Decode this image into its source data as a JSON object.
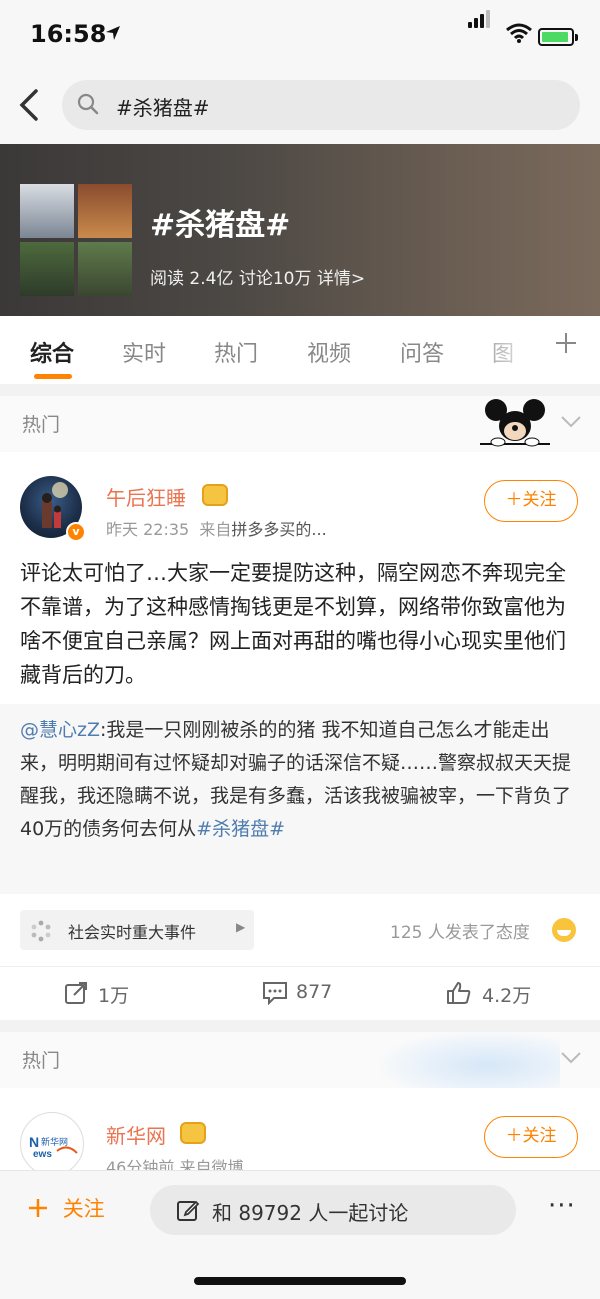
{
  "status_bar": {
    "time": "16:58",
    "location_icon": "location-arrow-icon",
    "battery_color": "#4cd964"
  },
  "search": {
    "query": "#杀猪盘#"
  },
  "topic": {
    "title": "#杀猪盘#",
    "stats": "阅读 2.4亿   讨论10万   详情>"
  },
  "tabs": [
    "综合",
    "实时",
    "热门",
    "视频",
    "问答",
    "图"
  ],
  "sections": {
    "hot_label": "热门"
  },
  "post": {
    "author": "午后狂睡",
    "time": "昨天 22:35",
    "source_prefix": "来自",
    "source": "拼多多买的...",
    "follow_label": "＋关注",
    "text": "评论太可怕了…大家一定要提防这种，隔空网恋不奔现完全不靠谱，为了这种感情掏钱更是不划算，网络带你致富他为啥不便宜自己亲属？网上面对再甜的嘴也得小心现实里他们藏背后的刀。",
    "repost_mention": "@慧心zZ",
    "repost_body": ":我是一只刚刚被杀的的猪 我不知道自己怎么才能走出来，明明期间有过怀疑却对骗子的话深信不疑……警察叔叔天天提醒我，我还隐瞒不说，我是有多蠢，活该我被骗被宰，一下背负了40万的债务何去何从",
    "repost_topic": "#杀猪盘#",
    "topic_chip": "社会实时重大事件",
    "attitude_text": "125 人发表了态度",
    "reposts": "1万",
    "comments": "877",
    "likes": "4.2万"
  },
  "post2": {
    "author": "新华网",
    "meta": "46分钟前  来自微博 ...",
    "follow_label": "＋关注"
  },
  "bottom_bar": {
    "follow_label": "关注",
    "discuss_label": "和 89792 人一起讨论",
    "more_label": "···"
  },
  "colors": {
    "accent": "#ff8200",
    "author_name": "#eb7350",
    "link": "#507daf"
  }
}
